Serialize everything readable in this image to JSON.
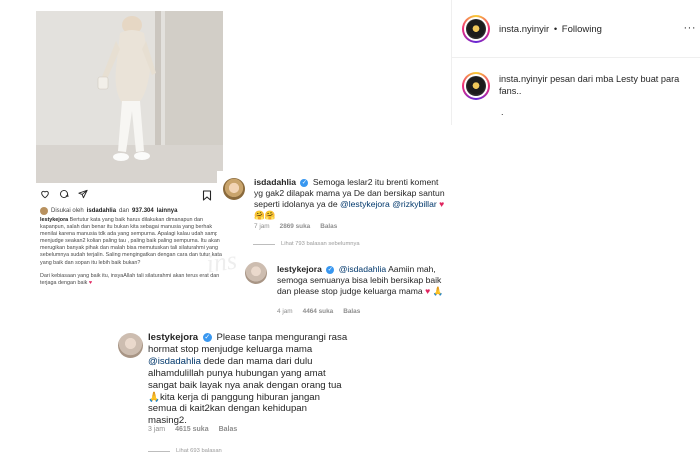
{
  "post": {
    "liked_by": {
      "prefix": "Disukai oleh",
      "user": "isdadahlia",
      "middle": "dan",
      "count": "937.304",
      "suffix": "lainnya"
    },
    "caption": {
      "user": "lestykejora",
      "p1": "Bertutur kata yang baik harus dilakukan dimanapun dan kapanpun, salah dan benar itu bukan kita sebagai manusia yang berhak menilai karena manusia tdk ada yang sempurna. Apalagi kalau udah sampai menjudge seakan2 kolian paling tau , paling baik paling sempurna. Itu akan merugikan banyak pihak dan malah bisa memutuskan tali silaturahmi yang sebelumnya sudah terjalin. Saling mengingatkan dengan cara dan tutur kata yang baik dan sopan itu lebih baik bukan?",
      "p2": "Dari kebiasaan yang baik itu, insyaAllah tali silaturahmi akan terus erat dan terjaga dengan baik"
    }
  },
  "watermark": "insta_nyinyir",
  "comments": [
    {
      "user": "isdadahlia",
      "text_a": "Semoga leslar2 itu brenti koment yg gak2 dilapak mama ya De dan bersikap santun seperti idolanya ya de",
      "mention1": "@lestykejora",
      "mention2": "@rizkybillar",
      "emoji": "♥ 🤗🤗",
      "time": "7 jam",
      "likes": "2869 suka",
      "reply": "Balas"
    },
    {
      "view_replies": "Lihat 793 balasan sebelumnya",
      "user": "lestykejora",
      "mention": "@isdadahlia",
      "text": "Aamiin mah, semoga semuanya bisa lebih bersikap baik dan please stop judge keluarga mama",
      "emoji": "♥ 🙏",
      "time": "4 jam",
      "likes": "4464 suka",
      "reply": "Balas"
    },
    {
      "user": "lestykejora",
      "text_a": "Please tanpa mengurangi rasa hormat stop menjudge keluarga mama",
      "mention": "@isdadahlia",
      "text_b": "dede dan mama dari dulu alhamdulillah punya hubungan yang amat sangat baik layak nya anak dengan orang tua🙏kita kerja di panggung hiburan jangan semua di kait2kan dengan kehidupan masing2.",
      "time": "3 jam",
      "likes": "4615 suka",
      "reply": "Balas",
      "view_replies": "Lihat 693 balasan"
    }
  ],
  "side": {
    "username": "insta.nyinyir",
    "separator": "•",
    "follow_label": "Following",
    "more_label": "···",
    "caption_user": "insta.nyinyir",
    "caption_text": "pesan dari mba Lesty buat para fans..",
    "caption_extra": "."
  }
}
